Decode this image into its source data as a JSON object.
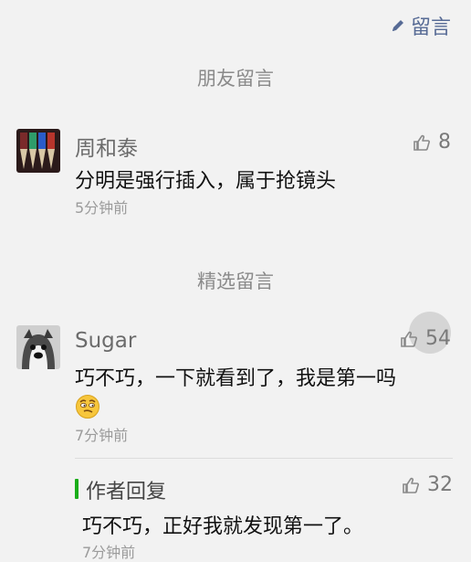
{
  "header": {
    "write_label": "留言"
  },
  "sections": {
    "friends_title": "朋友留言",
    "featured_title": "精选留言"
  },
  "friend_comment": {
    "name": "周和泰",
    "likes": "8",
    "text": "分明是强行插入，属于抢镜头",
    "time": "5分钟前"
  },
  "featured_comment": {
    "name": "Sugar",
    "likes": "54",
    "text": "巧不巧，一下就看到了，我是第一吗",
    "time": "7分钟前",
    "emoji": "thinking-emoji"
  },
  "author_reply": {
    "label": "作者回复",
    "likes": "32",
    "text": "巧不巧，正好我就发现第一了。",
    "time": "7分钟前"
  },
  "colors": {
    "link": "#576b95",
    "accent_green": "#1aad19"
  }
}
